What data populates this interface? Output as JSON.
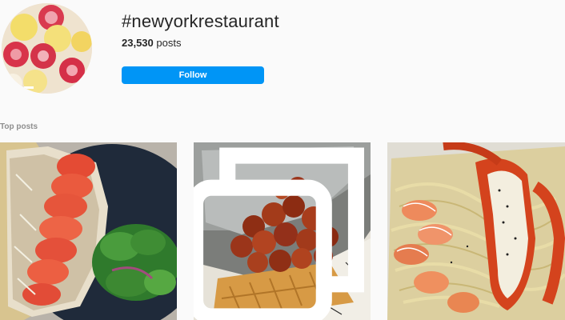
{
  "header": {
    "hashtag": "#newyorkrestaurant",
    "post_count": "23,530",
    "post_count_suffix": " posts",
    "follow_label": "Follow"
  },
  "top_posts": {
    "label": "Top posts",
    "items": [
      {
        "icon": "none"
      },
      {
        "icon": "carousel-icon"
      },
      {
        "icon": "none"
      }
    ]
  },
  "colors": {
    "accent": "#0095f6",
    "background": "#fafafa",
    "muted_text": "#8e8e8e"
  }
}
